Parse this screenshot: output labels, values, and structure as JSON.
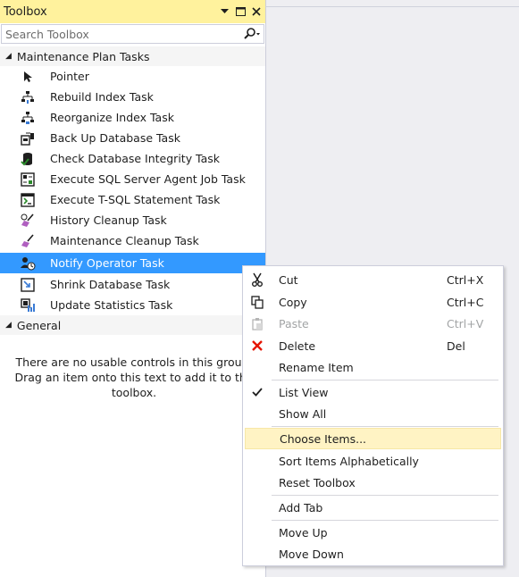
{
  "toolbox": {
    "title": "Toolbox",
    "search_placeholder": "Search Toolbox",
    "groups": [
      {
        "label": "Maintenance Plan Tasks",
        "expanded": true,
        "items": [
          {
            "label": "Pointer",
            "icon": "pointer-icon"
          },
          {
            "label": "Rebuild Index Task",
            "icon": "rebuild-index-icon"
          },
          {
            "label": "Reorganize Index Task",
            "icon": "reorganize-index-icon"
          },
          {
            "label": "Back Up Database Task",
            "icon": "backup-database-icon"
          },
          {
            "label": "Check Database Integrity Task",
            "icon": "check-integrity-icon"
          },
          {
            "label": "Execute SQL Server Agent Job Task",
            "icon": "agent-job-icon"
          },
          {
            "label": "Execute T-SQL Statement Task",
            "icon": "tsql-statement-icon"
          },
          {
            "label": "History Cleanup Task",
            "icon": "history-cleanup-icon"
          },
          {
            "label": "Maintenance Cleanup Task",
            "icon": "maintenance-cleanup-icon"
          },
          {
            "label": "Notify Operator Task",
            "icon": "notify-operator-icon",
            "selected": true
          },
          {
            "label": "Shrink Database Task",
            "icon": "shrink-database-icon"
          },
          {
            "label": "Update Statistics Task",
            "icon": "update-statistics-icon"
          }
        ]
      },
      {
        "label": "General",
        "expanded": true,
        "empty_message": [
          "There are no usable controls in this group.",
          "Drag an item onto this text to add it to the",
          "toolbox."
        ]
      }
    ]
  },
  "context_menu": {
    "items": [
      {
        "label": "Cut",
        "shortcut": "Ctrl+X",
        "icon": "scissors-icon"
      },
      {
        "label": "Copy",
        "shortcut": "Ctrl+C",
        "icon": "copy-icon"
      },
      {
        "label": "Paste",
        "shortcut": "Ctrl+V",
        "icon": "paste-icon",
        "disabled": true
      },
      {
        "label": "Delete",
        "shortcut": "Del",
        "icon": "delete-x-icon"
      },
      {
        "label": "Rename Item",
        "shortcut": ""
      },
      {
        "label": "List View",
        "shortcut": "",
        "icon": "checkmark-icon",
        "checked": true
      },
      {
        "label": "Show All",
        "shortcut": ""
      },
      {
        "label": "Choose Items...",
        "shortcut": "",
        "highlighted": true
      },
      {
        "label": "Sort Items Alphabetically",
        "shortcut": ""
      },
      {
        "label": "Reset Toolbox",
        "shortcut": ""
      },
      {
        "label": "Add Tab",
        "shortcut": ""
      },
      {
        "label": "Move Up",
        "shortcut": ""
      },
      {
        "label": "Move Down",
        "shortcut": ""
      }
    ]
  },
  "colors": {
    "title_bar": "#fff29d",
    "selection": "#3399ff",
    "menu_highlight": "#fff3c4",
    "delete_red": "#e51400"
  }
}
